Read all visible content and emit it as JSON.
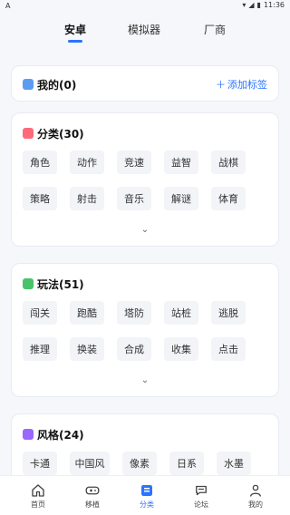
{
  "status": {
    "left_label": "A",
    "time": "11:36"
  },
  "top_tabs": [
    {
      "label": "安卓",
      "active": true
    },
    {
      "label": "模拟器",
      "active": false
    },
    {
      "label": "厂商",
      "active": false
    }
  ],
  "mine": {
    "title": "我的(0)",
    "add_tag": "添加标签",
    "icon": "bookmark-icon",
    "icon_color": "#5b9cf2"
  },
  "categories": {
    "title": "分类(30)",
    "icon": "category-icon",
    "icon_color": "#ff6a7a",
    "tags": [
      "角色",
      "动作",
      "竞速",
      "益智",
      "战棋",
      "策略",
      "射击",
      "音乐",
      "解谜",
      "体育"
    ]
  },
  "gameplay": {
    "title": "玩法(51)",
    "icon": "controller-icon",
    "icon_color": "#48c36a",
    "tags": [
      "闯关",
      "跑酷",
      "塔防",
      "站桩",
      "逃脱",
      "推理",
      "换装",
      "合成",
      "收集",
      "点击"
    ]
  },
  "style": {
    "title": "风格(24)",
    "icon": "palette-icon",
    "icon_color": "#9a67ff",
    "tags": [
      "卡通",
      "中国风",
      "像素",
      "日系",
      "水墨"
    ]
  },
  "bottom_nav": [
    {
      "label": "首页",
      "icon": "home-icon",
      "active": false
    },
    {
      "label": "移植",
      "icon": "gamepad-icon",
      "active": false
    },
    {
      "label": "分类",
      "icon": "category-icon",
      "active": true
    },
    {
      "label": "论坛",
      "icon": "chat-icon",
      "active": false
    },
    {
      "label": "我的",
      "icon": "profile-icon",
      "active": false
    }
  ],
  "colors": {
    "accent": "#2a74ff",
    "background": "#f6f7fb"
  }
}
